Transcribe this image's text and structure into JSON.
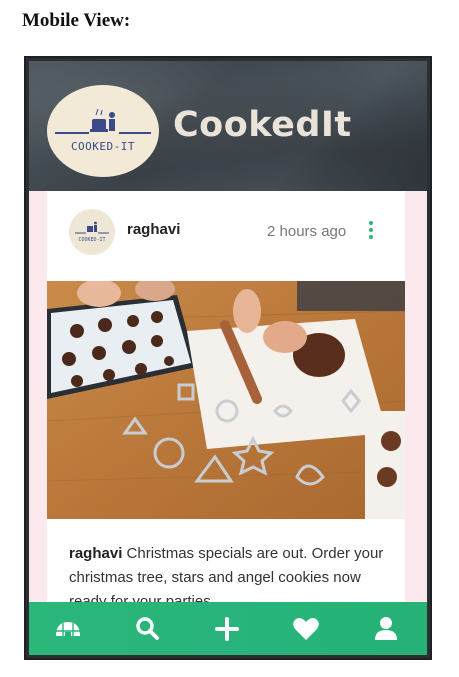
{
  "page_title": "Mobile View:",
  "app": {
    "brand_name": "CookedIt",
    "logo_text": "COOKED-IT"
  },
  "post": {
    "username": "raghavi",
    "time_ago": "2 hours ago",
    "caption_user": "raghavi",
    "caption_text": "Christmas specials are out. Order your christmas tree, stars and angel cookies now ready for your parties"
  },
  "nav": {
    "items": [
      "home-icon",
      "search-icon",
      "add-icon",
      "heart-icon",
      "profile-icon"
    ]
  },
  "colors": {
    "accent": "#2bb67a",
    "header_bg": "#3f474e",
    "brand_text": "#e9e3d9",
    "page_bg": "#fbe9ee"
  }
}
